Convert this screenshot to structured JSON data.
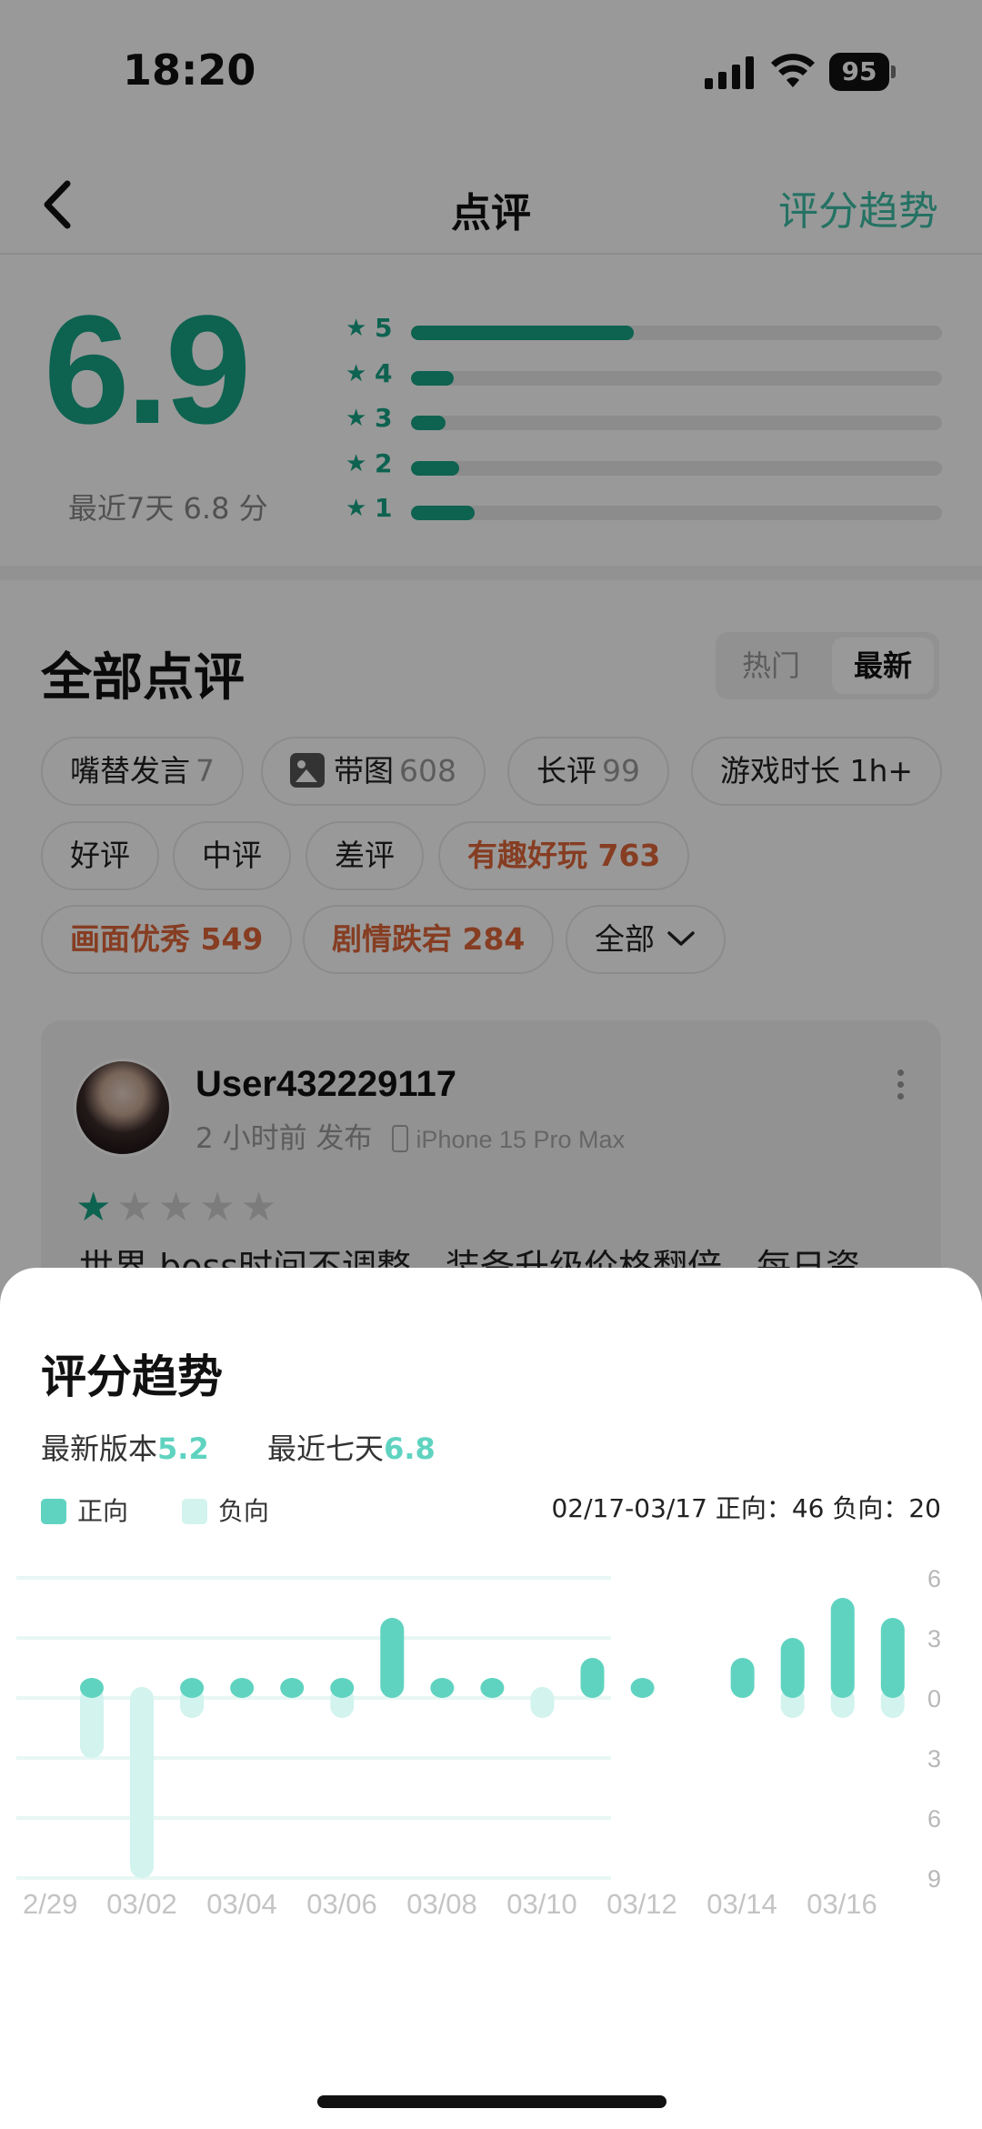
{
  "status_bar": {
    "time": "18:20",
    "battery": "95"
  },
  "nav": {
    "title": "点评",
    "action": "评分趋势"
  },
  "rating": {
    "score": "6.9",
    "recent": "最近7天 6.8 分",
    "distribution": [
      {
        "stars": "5",
        "fraction": 0.42
      },
      {
        "stars": "4",
        "fraction": 0.08
      },
      {
        "stars": "3",
        "fraction": 0.065
      },
      {
        "stars": "2",
        "fraction": 0.09
      },
      {
        "stars": "1",
        "fraction": 0.12
      }
    ]
  },
  "reviews": {
    "title": "全部点评",
    "sort": {
      "hot": "热门",
      "latest": "最新"
    },
    "filters": [
      {
        "label": "嘴替发言",
        "count": "7"
      },
      {
        "label": "带图",
        "count": "608",
        "icon": "image-icon"
      },
      {
        "label": "长评",
        "count": "99"
      },
      {
        "label": "游戏时长 1h+",
        "count": ""
      },
      {
        "label": "好评",
        "count": ""
      },
      {
        "label": "中评",
        "count": ""
      },
      {
        "label": "差评",
        "count": ""
      },
      {
        "label": "有趣好玩 763",
        "count": "",
        "highlight": true
      },
      {
        "label": "画面优秀 549",
        "count": "",
        "highlight": true
      },
      {
        "label": "剧情跌宕 284",
        "count": "",
        "highlight": true
      },
      {
        "label": "全部",
        "count": "",
        "dropdown": true
      }
    ],
    "card": {
      "username": "User432229117",
      "time": "2 小时前 发布",
      "device": "iPhone 15 Pro Max",
      "stars": 1,
      "text": "世界 boss时间不调整，装备升级价格翻倍，每日资"
    }
  },
  "sheet": {
    "title": "评分趋势",
    "latest_version_label": "最新版本",
    "latest_version_value": "5.2",
    "last7_label": "最近七天",
    "last7_value": "6.8",
    "legend_positive": "正向",
    "legend_negative": "负向",
    "period": "02/17-03/17 正向：46 负向：20"
  },
  "colors": {
    "accent": "#16a385",
    "positive": "#5fd3c0",
    "negative": "#d2f3ee",
    "highlight": "#e0663a"
  },
  "chart_data": {
    "type": "bar",
    "x": [
      "02/29",
      "03/01",
      "03/02",
      "03/03",
      "03/04",
      "03/05",
      "03/06",
      "03/07",
      "03/08",
      "03/09",
      "03/10",
      "03/11",
      "03/12",
      "03/13",
      "03/14",
      "03/15",
      "03/16",
      "03/17"
    ],
    "series": [
      {
        "name": "正向",
        "values": [
          1,
          0,
          1,
          1,
          1,
          1,
          4,
          1,
          1,
          0,
          2,
          1,
          0,
          2,
          3,
          5,
          4,
          0
        ]
      },
      {
        "name": "负向",
        "values": [
          3,
          9,
          1,
          0,
          0,
          1,
          0,
          0,
          0,
          1,
          0,
          0,
          0,
          0,
          1,
          1,
          1,
          0
        ]
      }
    ],
    "x_tick_labels": [
      "2/29",
      "03/02",
      "03/04",
      "03/06",
      "03/08",
      "03/10",
      "03/12",
      "03/14",
      "03/16"
    ],
    "y_tick_labels": [
      "6",
      "3",
      "0",
      "3",
      "6",
      "9"
    ],
    "ylim": [
      -9,
      6
    ]
  }
}
